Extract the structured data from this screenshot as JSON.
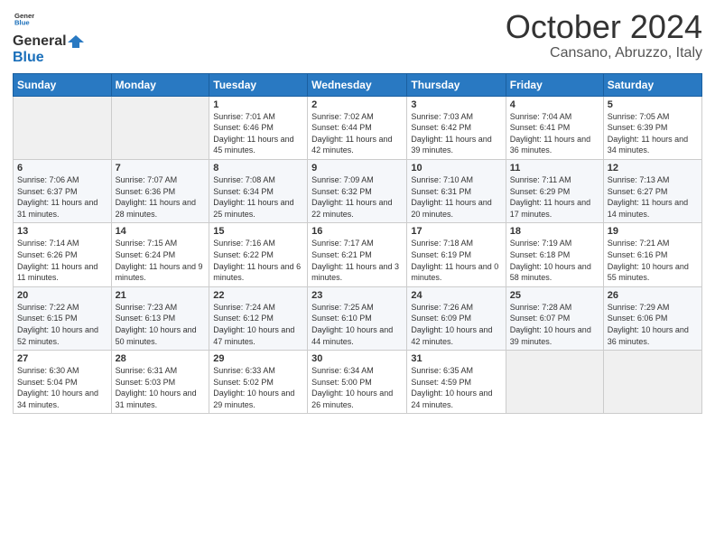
{
  "header": {
    "logo_general": "General",
    "logo_blue": "Blue",
    "month_title": "October 2024",
    "location": "Cansano, Abruzzo, Italy"
  },
  "weekdays": [
    "Sunday",
    "Monday",
    "Tuesday",
    "Wednesday",
    "Thursday",
    "Friday",
    "Saturday"
  ],
  "weeks": [
    [
      {
        "day": "",
        "info": ""
      },
      {
        "day": "",
        "info": ""
      },
      {
        "day": "1",
        "info": "Sunrise: 7:01 AM\nSunset: 6:46 PM\nDaylight: 11 hours and 45 minutes."
      },
      {
        "day": "2",
        "info": "Sunrise: 7:02 AM\nSunset: 6:44 PM\nDaylight: 11 hours and 42 minutes."
      },
      {
        "day": "3",
        "info": "Sunrise: 7:03 AM\nSunset: 6:42 PM\nDaylight: 11 hours and 39 minutes."
      },
      {
        "day": "4",
        "info": "Sunrise: 7:04 AM\nSunset: 6:41 PM\nDaylight: 11 hours and 36 minutes."
      },
      {
        "day": "5",
        "info": "Sunrise: 7:05 AM\nSunset: 6:39 PM\nDaylight: 11 hours and 34 minutes."
      }
    ],
    [
      {
        "day": "6",
        "info": "Sunrise: 7:06 AM\nSunset: 6:37 PM\nDaylight: 11 hours and 31 minutes."
      },
      {
        "day": "7",
        "info": "Sunrise: 7:07 AM\nSunset: 6:36 PM\nDaylight: 11 hours and 28 minutes."
      },
      {
        "day": "8",
        "info": "Sunrise: 7:08 AM\nSunset: 6:34 PM\nDaylight: 11 hours and 25 minutes."
      },
      {
        "day": "9",
        "info": "Sunrise: 7:09 AM\nSunset: 6:32 PM\nDaylight: 11 hours and 22 minutes."
      },
      {
        "day": "10",
        "info": "Sunrise: 7:10 AM\nSunset: 6:31 PM\nDaylight: 11 hours and 20 minutes."
      },
      {
        "day": "11",
        "info": "Sunrise: 7:11 AM\nSunset: 6:29 PM\nDaylight: 11 hours and 17 minutes."
      },
      {
        "day": "12",
        "info": "Sunrise: 7:13 AM\nSunset: 6:27 PM\nDaylight: 11 hours and 14 minutes."
      }
    ],
    [
      {
        "day": "13",
        "info": "Sunrise: 7:14 AM\nSunset: 6:26 PM\nDaylight: 11 hours and 11 minutes."
      },
      {
        "day": "14",
        "info": "Sunrise: 7:15 AM\nSunset: 6:24 PM\nDaylight: 11 hours and 9 minutes."
      },
      {
        "day": "15",
        "info": "Sunrise: 7:16 AM\nSunset: 6:22 PM\nDaylight: 11 hours and 6 minutes."
      },
      {
        "day": "16",
        "info": "Sunrise: 7:17 AM\nSunset: 6:21 PM\nDaylight: 11 hours and 3 minutes."
      },
      {
        "day": "17",
        "info": "Sunrise: 7:18 AM\nSunset: 6:19 PM\nDaylight: 11 hours and 0 minutes."
      },
      {
        "day": "18",
        "info": "Sunrise: 7:19 AM\nSunset: 6:18 PM\nDaylight: 10 hours and 58 minutes."
      },
      {
        "day": "19",
        "info": "Sunrise: 7:21 AM\nSunset: 6:16 PM\nDaylight: 10 hours and 55 minutes."
      }
    ],
    [
      {
        "day": "20",
        "info": "Sunrise: 7:22 AM\nSunset: 6:15 PM\nDaylight: 10 hours and 52 minutes."
      },
      {
        "day": "21",
        "info": "Sunrise: 7:23 AM\nSunset: 6:13 PM\nDaylight: 10 hours and 50 minutes."
      },
      {
        "day": "22",
        "info": "Sunrise: 7:24 AM\nSunset: 6:12 PM\nDaylight: 10 hours and 47 minutes."
      },
      {
        "day": "23",
        "info": "Sunrise: 7:25 AM\nSunset: 6:10 PM\nDaylight: 10 hours and 44 minutes."
      },
      {
        "day": "24",
        "info": "Sunrise: 7:26 AM\nSunset: 6:09 PM\nDaylight: 10 hours and 42 minutes."
      },
      {
        "day": "25",
        "info": "Sunrise: 7:28 AM\nSunset: 6:07 PM\nDaylight: 10 hours and 39 minutes."
      },
      {
        "day": "26",
        "info": "Sunrise: 7:29 AM\nSunset: 6:06 PM\nDaylight: 10 hours and 36 minutes."
      }
    ],
    [
      {
        "day": "27",
        "info": "Sunrise: 6:30 AM\nSunset: 5:04 PM\nDaylight: 10 hours and 34 minutes."
      },
      {
        "day": "28",
        "info": "Sunrise: 6:31 AM\nSunset: 5:03 PM\nDaylight: 10 hours and 31 minutes."
      },
      {
        "day": "29",
        "info": "Sunrise: 6:33 AM\nSunset: 5:02 PM\nDaylight: 10 hours and 29 minutes."
      },
      {
        "day": "30",
        "info": "Sunrise: 6:34 AM\nSunset: 5:00 PM\nDaylight: 10 hours and 26 minutes."
      },
      {
        "day": "31",
        "info": "Sunrise: 6:35 AM\nSunset: 4:59 PM\nDaylight: 10 hours and 24 minutes."
      },
      {
        "day": "",
        "info": ""
      },
      {
        "day": "",
        "info": ""
      }
    ]
  ]
}
